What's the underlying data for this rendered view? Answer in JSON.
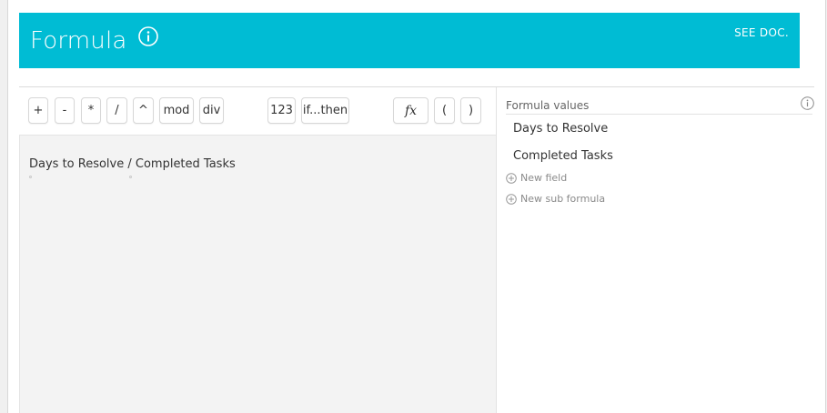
{
  "header": {
    "title": "Formula",
    "doc_link": "SEE DOC.",
    "bg_color": "#00bcd4"
  },
  "toolbar": {
    "buttons": [
      {
        "label": "+"
      },
      {
        "label": "-"
      },
      {
        "label": "*"
      },
      {
        "label": "/"
      },
      {
        "label": "^"
      },
      {
        "label": "mod"
      },
      {
        "label": "div"
      },
      {
        "label": "123"
      },
      {
        "label": "if...then"
      },
      {
        "label": "fx"
      },
      {
        "label": "("
      },
      {
        "label": ")"
      }
    ]
  },
  "editor": {
    "expression": "Days to Resolve / Completed Tasks"
  },
  "formula_values": {
    "title": "Formula values",
    "items": [
      "Days to Resolve",
      "Completed Tasks"
    ],
    "new_field": "New field",
    "new_sub_formula": "New sub formula"
  }
}
